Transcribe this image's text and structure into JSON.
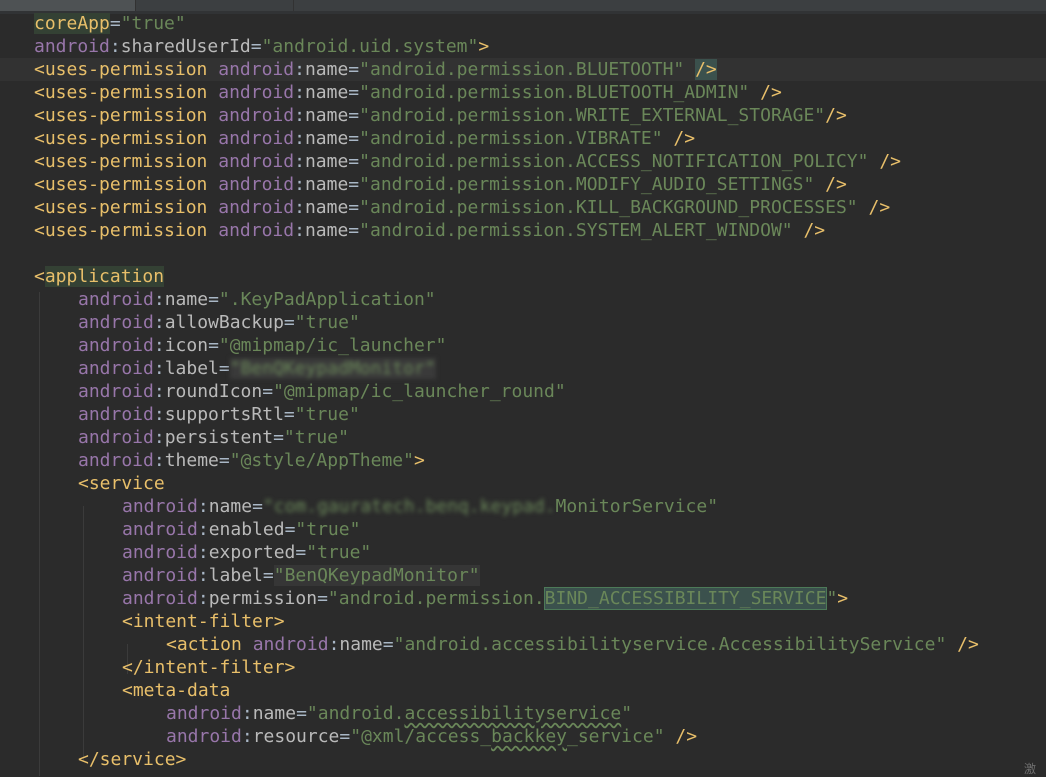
{
  "tabs": [
    {
      "label": ""
    },
    {
      "label": ""
    }
  ],
  "colors": {
    "background": "#2b2b2b",
    "tag": "#e8bf6a",
    "namespace": "#9876aa",
    "attribute": "#bababa",
    "value": "#6a8759",
    "selection": "#3b514d"
  },
  "code": {
    "l01": {
      "attr": "coreApp",
      "val": "\"true\""
    },
    "l02": {
      "ns": "android",
      "attr": "sharedUserId",
      "val": "\"android.uid.system\"",
      "end": ">"
    },
    "perm_tag": "<uses-permission",
    "ns": "android",
    "name_attr": "name",
    "perm_end": "/>",
    "l03": {
      "val": "\"android.permission.BLUETOOTH\""
    },
    "l04": {
      "val": "\"android.permission.BLUETOOTH_ADMIN\""
    },
    "l05": {
      "val": "\"android.permission.WRITE_EXTERNAL_STORAGE\""
    },
    "l06": {
      "val": "\"android.permission.VIBRATE\""
    },
    "l07": {
      "val": "\"android.permission.ACCESS_NOTIFICATION_POLICY\""
    },
    "l08": {
      "val": "\"android.permission.MODIFY_AUDIO_SETTINGS\""
    },
    "l09": {
      "val": "\"android.permission.KILL_BACKGROUND_PROCESSES\""
    },
    "l10": {
      "val": "\"android.permission.SYSTEM_ALERT_WINDOW\""
    },
    "l12": {
      "lt": "<",
      "tag": "application"
    },
    "l13": {
      "attr": "name",
      "val": "\".KeyPadApplication\""
    },
    "l14": {
      "attr": "allowBackup",
      "val": "\"true\""
    },
    "l15": {
      "attr": "icon",
      "val": "\"@mipmap/ic_launcher\""
    },
    "l16": {
      "attr": "label",
      "val": "\"BenQKeypadMonitor\""
    },
    "l17": {
      "attr": "roundIcon",
      "val": "\"@mipmap/ic_launcher_round\""
    },
    "l18": {
      "attr": "supportsRtl",
      "val": "\"true\""
    },
    "l19": {
      "attr": "persistent",
      "val": "\"true\""
    },
    "l20": {
      "attr": "theme",
      "val": "\"@style/AppTheme\"",
      "end": ">"
    },
    "l21": {
      "tag": "<service"
    },
    "l22": {
      "attr": "name",
      "val_hidden": "\"com.gauratech.benq.keypad.",
      "val": "MonitorService\""
    },
    "l23": {
      "attr": "enabled",
      "val": "\"true\""
    },
    "l24": {
      "attr": "exported",
      "val": "\"true\""
    },
    "l25": {
      "attr": "label",
      "val": "\"BenQKeypadMonitor\""
    },
    "l26": {
      "attr": "permission",
      "val_a": "\"android.permission.",
      "val_b": "BIND_ACCESSIBILITY_SERVICE",
      "val_c": "\"",
      "end": ">"
    },
    "l27": {
      "tag": "<intent-filter>"
    },
    "l28": {
      "tag": "<action",
      "attr": "name",
      "val": "\"android.accessibilityservice.AccessibilityService\"",
      "end": "/>"
    },
    "l29": {
      "tag": "</intent-filter>"
    },
    "l30": {
      "tag": "<meta-data"
    },
    "l31": {
      "attr": "name",
      "val_a": "\"android.",
      "val_b": "accessibilityservice",
      "val_c": "\""
    },
    "l32": {
      "attr": "resource",
      "val_a": "\"@xml/access_",
      "val_b": "backkey",
      "val_c": "_service\"",
      "end": "/>"
    },
    "l33": {
      "tag": "</service>"
    }
  },
  "ime_indicator": "激"
}
